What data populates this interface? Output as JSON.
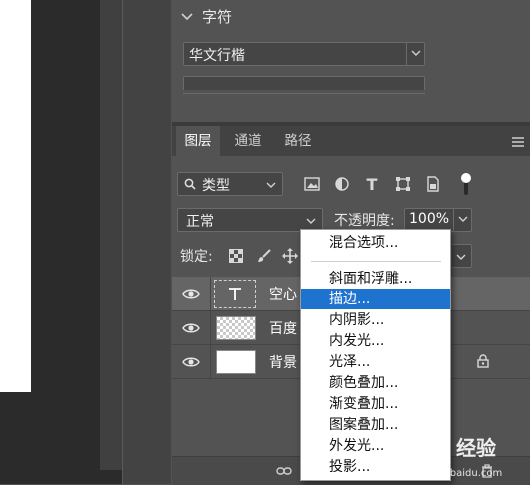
{
  "character_panel": {
    "title": "字符",
    "font_family": "华文行楷"
  },
  "layers_panel": {
    "tabs": [
      "图层",
      "通道",
      "路径"
    ],
    "filter_label": "类型",
    "blend_mode": "正常",
    "opacity_label": "不透明度:",
    "opacity_value": "100%",
    "lock_label": "锁定:",
    "layers": [
      {
        "name": "空心字",
        "visible_name": "空心"
      },
      {
        "name": "百度经验",
        "visible_name": "百度"
      },
      {
        "name": "背景",
        "visible_name": "背景"
      }
    ]
  },
  "context_menu": {
    "items": [
      {
        "label": "混合选项...",
        "highlighted": false
      },
      {
        "label": "斜面和浮雕...",
        "highlighted": false
      },
      {
        "label": "描边...",
        "highlighted": true
      },
      {
        "label": "内阴影...",
        "highlighted": false
      },
      {
        "label": "内发光...",
        "highlighted": false
      },
      {
        "label": "光泽...",
        "highlighted": false
      },
      {
        "label": "颜色叠加...",
        "highlighted": false
      },
      {
        "label": "渐变叠加...",
        "highlighted": false
      },
      {
        "label": "图案叠加...",
        "highlighted": false
      },
      {
        "label": "外发光...",
        "highlighted": false
      },
      {
        "label": "投影...",
        "highlighted": false
      }
    ]
  },
  "watermark": {
    "text": "经验",
    "url": "jingyan.baidu.com"
  },
  "colors": {
    "panel_bg": "#535353",
    "highlight": "#1e73cf"
  }
}
